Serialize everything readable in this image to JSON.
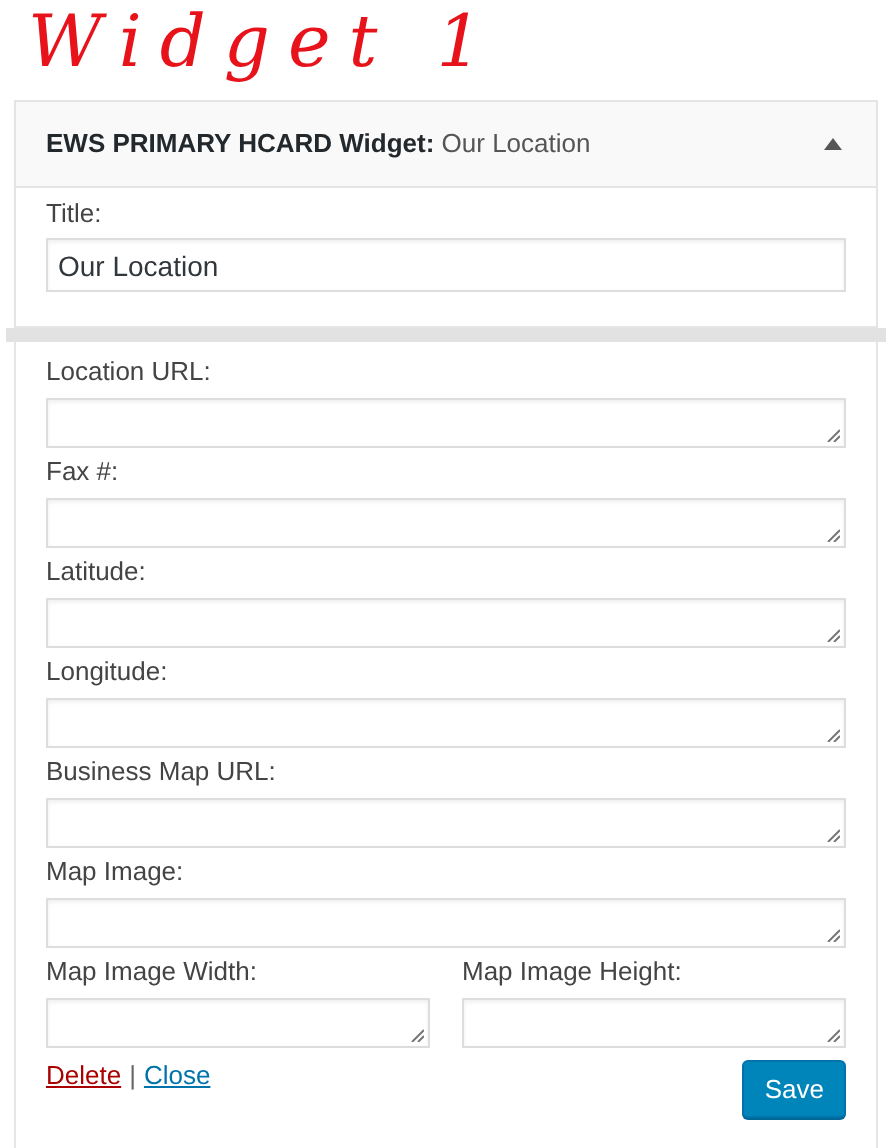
{
  "annotation": "Widget 1",
  "widget": {
    "name": "EWS PRIMARY HCARD Widget:",
    "instance_title": "Our Location",
    "expanded": true
  },
  "title_field": {
    "label": "Title:",
    "value": "Our Location"
  },
  "fields": [
    {
      "label": "Location URL:",
      "kind": "full"
    },
    {
      "label": "Fax #:",
      "kind": "full"
    },
    {
      "label": "Latitude:",
      "kind": "full"
    },
    {
      "label": "Longitude:",
      "kind": "full"
    },
    {
      "label": "Business Map URL:",
      "kind": "full"
    },
    {
      "label": "Map Image:",
      "kind": "full"
    },
    {
      "label": "Map Image Width:",
      "kind": "half"
    },
    {
      "label": "Map Image Height:",
      "kind": "half"
    }
  ],
  "links": {
    "delete": "Delete",
    "separator": "|",
    "close": "Close"
  },
  "save_button": "Save"
}
